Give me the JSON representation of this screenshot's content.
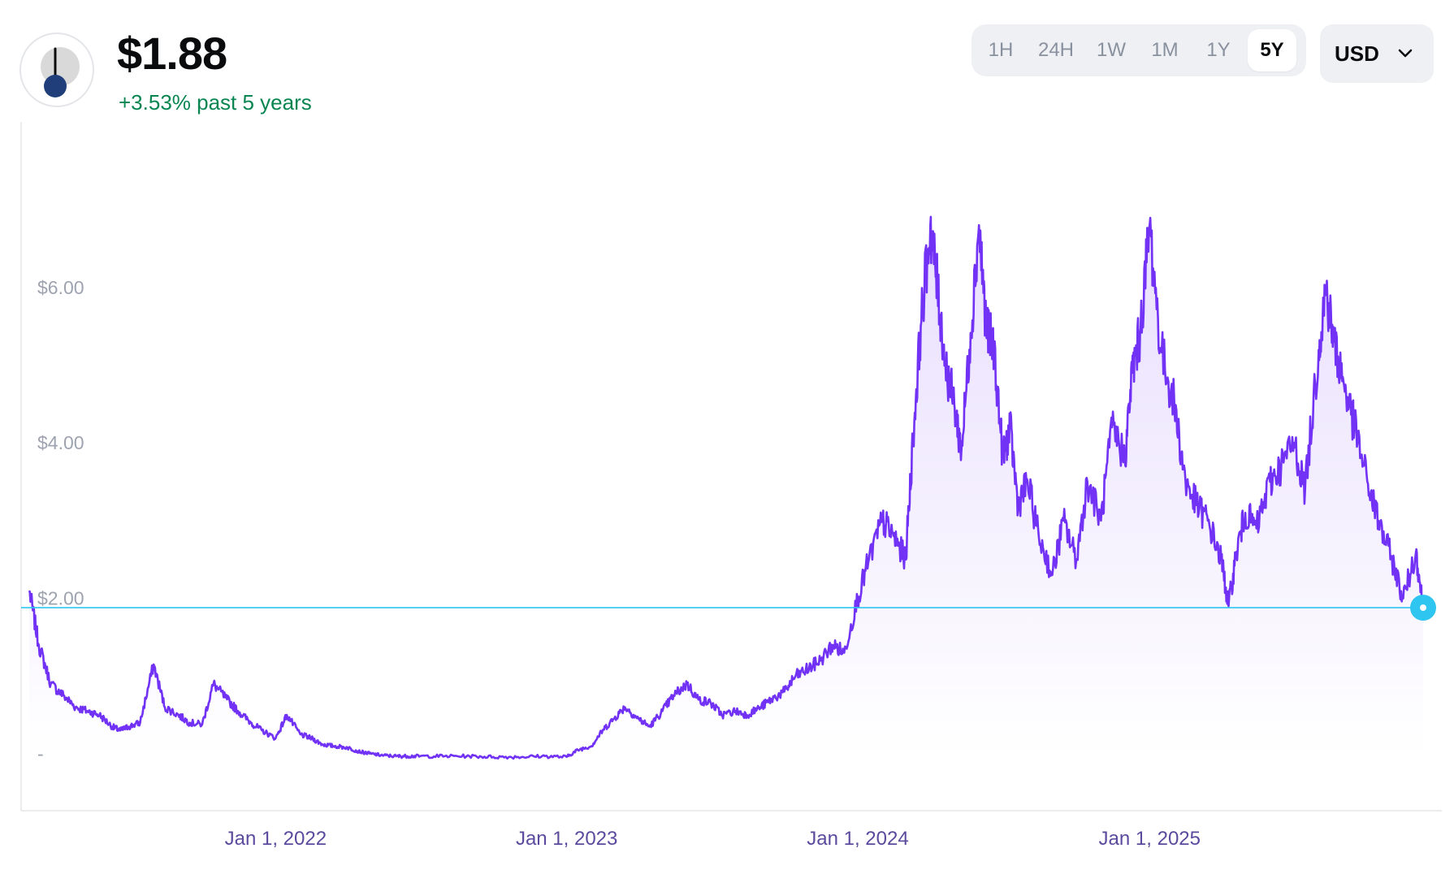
{
  "header": {
    "logo_icon": "chronometer-gauge-icon",
    "price": "$1.88",
    "change": "+3.53% past 5 years",
    "change_color": "#098551"
  },
  "range_selector": {
    "options": [
      "1H",
      "24H",
      "1W",
      "1M",
      "1Y",
      "5Y"
    ],
    "active": "5Y"
  },
  "currency_selector": {
    "label": "USD",
    "icon": "chevron-down-icon"
  },
  "chart_data": {
    "type": "area",
    "x_axis": {
      "tick_labels": [
        "Jan 1, 2022",
        "Jan 1, 2023",
        "Jan 1, 2024",
        "Jan 1, 2025"
      ]
    },
    "y_axis": {
      "tick_labels": [
        "-",
        "$2.00",
        "$4.00",
        "$6.00"
      ],
      "tick_values": [
        0,
        2,
        4,
        6
      ],
      "ylim": [
        -0.7,
        8.0
      ]
    },
    "grid": false,
    "line_color": "#7132f5",
    "current_price_line_color": "#2ec5f0",
    "current_value": 1.88,
    "series": [
      {
        "x": [
          "2021-02-26",
          "2021-03-10",
          "2021-03-25",
          "2021-04-10",
          "2021-04-25",
          "2021-05-10",
          "2021-05-25",
          "2021-06-10",
          "2021-06-20",
          "2021-07-01",
          "2021-07-15",
          "2021-08-01",
          "2021-08-15",
          "2021-09-01",
          "2021-09-15",
          "2021-10-01",
          "2021-10-15",
          "2021-11-01",
          "2021-11-15",
          "2021-12-01",
          "2021-12-15",
          "2022-01-01",
          "2022-01-15",
          "2022-02-01",
          "2022-02-15",
          "2022-03-01",
          "2022-03-15",
          "2022-04-01",
          "2022-04-15",
          "2022-05-01",
          "2022-05-15",
          "2022-06-01",
          "2022-06-15",
          "2022-07-01",
          "2022-08-01",
          "2022-09-01",
          "2022-10-01",
          "2022-11-01",
          "2022-12-01",
          "2023-01-01",
          "2023-01-15",
          "2023-02-01",
          "2023-02-15",
          "2023-03-01",
          "2023-03-15",
          "2023-04-01",
          "2023-04-15",
          "2023-05-01",
          "2023-05-15",
          "2023-06-01",
          "2023-06-15",
          "2023-07-01",
          "2023-07-15",
          "2023-08-01",
          "2023-08-15",
          "2023-09-01",
          "2023-09-15",
          "2023-10-01",
          "2023-10-15",
          "2023-11-01",
          "2023-11-15",
          "2023-12-01",
          "2023-12-15",
          "2024-01-01",
          "2024-01-15",
          "2024-02-01",
          "2024-02-15",
          "2024-03-01",
          "2024-03-10",
          "2024-03-20",
          "2024-04-01",
          "2024-04-10",
          "2024-04-20",
          "2024-05-01",
          "2024-05-10",
          "2024-05-20",
          "2024-06-01",
          "2024-06-10",
          "2024-06-20",
          "2024-07-01",
          "2024-07-10",
          "2024-07-20",
          "2024-08-01",
          "2024-08-15",
          "2024-09-01",
          "2024-09-15",
          "2024-10-01",
          "2024-10-15",
          "2024-11-01",
          "2024-11-15",
          "2024-12-01",
          "2024-12-10",
          "2024-12-20",
          "2025-01-01",
          "2025-01-15",
          "2025-02-01",
          "2025-02-15",
          "2025-03-01",
          "2025-03-15",
          "2025-04-01",
          "2025-04-10",
          "2025-04-20",
          "2025-05-01",
          "2025-05-15",
          "2025-06-01",
          "2025-06-15",
          "2025-07-01",
          "2025-07-15",
          "2025-08-01",
          "2025-08-10",
          "2025-08-20",
          "2025-09-01",
          "2025-09-15",
          "2025-10-01",
          "2025-10-15",
          "2025-11-01",
          "2025-11-15",
          "2025-12-01",
          "2025-12-10"
        ],
        "y": [
          2.1,
          1.4,
          0.9,
          0.75,
          0.6,
          0.55,
          0.5,
          0.35,
          0.3,
          0.35,
          0.4,
          1.15,
          0.6,
          0.5,
          0.4,
          0.38,
          0.9,
          0.7,
          0.55,
          0.4,
          0.3,
          0.2,
          0.5,
          0.25,
          0.2,
          0.12,
          0.1,
          0.08,
          0.03,
          0.0,
          -0.02,
          -0.03,
          -0.03,
          -0.03,
          -0.03,
          -0.03,
          -0.04,
          -0.04,
          -0.03,
          -0.04,
          0.05,
          0.1,
          0.3,
          0.45,
          0.6,
          0.45,
          0.35,
          0.55,
          0.75,
          0.9,
          0.7,
          0.65,
          0.5,
          0.55,
          0.5,
          0.6,
          0.7,
          0.8,
          1.0,
          1.1,
          1.2,
          1.4,
          1.3,
          2.0,
          2.5,
          3.0,
          2.8,
          2.5,
          4.0,
          5.5,
          6.8,
          6.0,
          5.0,
          4.5,
          3.9,
          5.2,
          6.8,
          5.5,
          5.2,
          3.8,
          4.2,
          3.2,
          3.5,
          2.8,
          2.3,
          3.0,
          2.5,
          3.5,
          3.0,
          4.2,
          3.8,
          4.9,
          5.4,
          6.8,
          5.2,
          4.5,
          3.5,
          3.2,
          3.0,
          2.5,
          1.9,
          2.6,
          3.1,
          2.9,
          3.5,
          3.7,
          4.0,
          3.4,
          5.2,
          6.0,
          5.3,
          4.8,
          4.2,
          3.5,
          3.0,
          2.5,
          2.0,
          2.6,
          1.88
        ]
      }
    ]
  }
}
